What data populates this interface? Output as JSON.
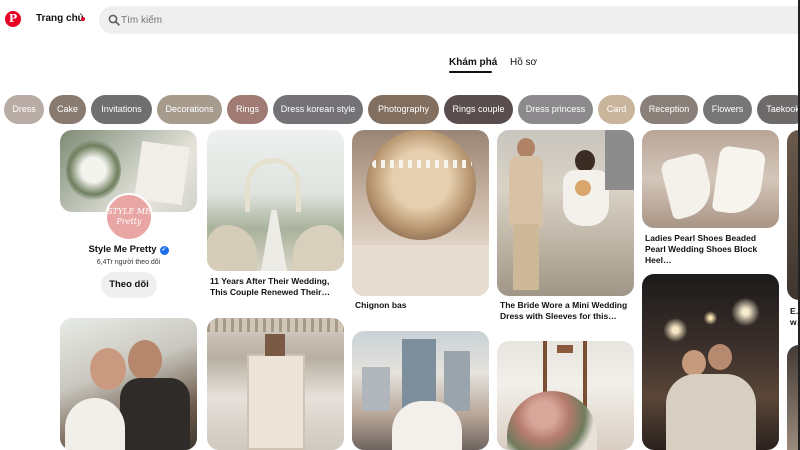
{
  "header": {
    "home_label": "Trang chủ",
    "search_placeholder": "Tìm kiếm"
  },
  "tabs": [
    {
      "label": "Khám phá",
      "active": true
    },
    {
      "label": "Hồ sơ",
      "active": false
    }
  ],
  "chips": [
    {
      "label": "Dress",
      "color": "#b9aca5"
    },
    {
      "label": "Cake",
      "color": "#8a7b71"
    },
    {
      "label": "Invitations",
      "color": "#6f6f70"
    },
    {
      "label": "Decorations",
      "color": "#a69b8d"
    },
    {
      "label": "Rings",
      "color": "#a07b74"
    },
    {
      "label": "Dress korean style",
      "color": "#757277"
    },
    {
      "label": "Photography",
      "color": "#826f5f"
    },
    {
      "label": "Rings couple",
      "color": "#5a4d4d"
    },
    {
      "label": "Dress princess",
      "color": "#8c8a8c"
    },
    {
      "label": "Card",
      "color": "#c9b49c"
    },
    {
      "label": "Reception",
      "color": "#8b8079"
    },
    {
      "label": "Flowers",
      "color": "#777677"
    },
    {
      "label": "Taekook",
      "color": "#6e6a6a"
    }
  ],
  "profile": {
    "avatar_text": "STYLE ME Pretty",
    "name": "Style Me Pretty",
    "verified": "✓",
    "followers": "6,4Tr người theo dõi",
    "follow_label": "Theo dõi"
  },
  "pins": {
    "arch": {
      "title": "11 Years After Their Wedding, This Couple Renewed Their…"
    },
    "chignon": {
      "title": "Chignon bas"
    },
    "couple": {
      "title": "The Bride Wore a Mini Wedding Dress with Sleeves for this…"
    },
    "shoes": {
      "title": "Ladies Pearl Shoes Beaded Pearl Wedding Shoes Block Heel…"
    },
    "edge": {
      "title": "E… w…"
    }
  }
}
